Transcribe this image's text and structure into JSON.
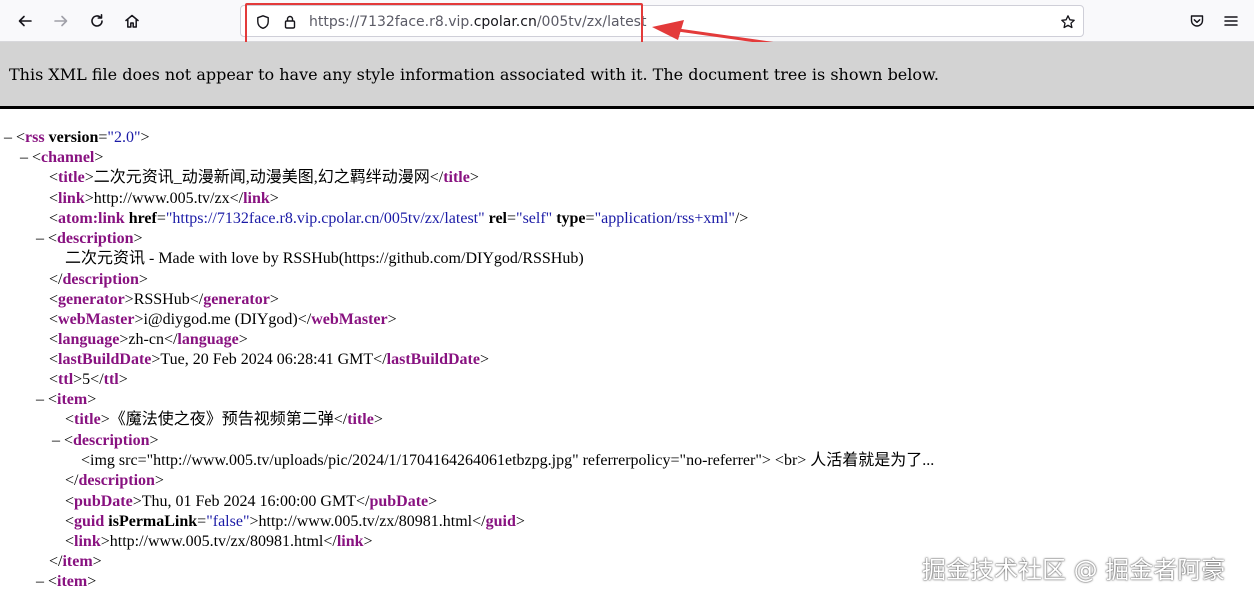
{
  "toolbar": {
    "back_icon": "back-arrow-icon",
    "forward_icon": "forward-arrow-icon",
    "reload_icon": "reload-icon",
    "home_icon": "home-icon",
    "shield_icon": "tracking-protection-shield-icon",
    "lock_icon": "lock-icon",
    "url_prefix": "https://7132face.r8.vip.",
    "url_host": "cpolar.cn",
    "url_path": "/005tv/zx/latest",
    "bookmark_icon": "star-icon",
    "pocket_icon": "pocket-icon",
    "menu_icon": "hamburger-menu-icon",
    "annotation_color": "#e33a3a"
  },
  "banner": {
    "text": "This XML file does not appear to have any style information associated with it. The document tree is shown below."
  },
  "xml": {
    "rss_tag": "rss",
    "rss_attr": "version",
    "rss_val": "\"2.0\"",
    "channel_tag": "channel",
    "title_tag": "title",
    "channel_title": "二次元资讯_动漫新闻,动漫美图,幻之羁绊动漫网",
    "link_tag": "link",
    "channel_link": "http://www.005.tv/zx",
    "atom_tag": "atom:link",
    "atom_href_attr": "href",
    "atom_href_val": "\"https://7132face.r8.vip.cpolar.cn/005tv/zx/latest\"",
    "atom_rel_attr": "rel",
    "atom_rel_val": "\"self\"",
    "atom_type_attr": "type",
    "atom_type_val": "\"application/rss+xml\"",
    "description_tag": "description",
    "channel_description": "二次元资讯 - Made with love by RSSHub(https://github.com/DIYgod/RSSHub)",
    "generator_tag": "generator",
    "generator": "RSSHub",
    "webmaster_tag": "webMaster",
    "webmaster": "i@diygod.me (DIYgod)",
    "language_tag": "language",
    "language": "zh-cn",
    "lastbuild_tag": "lastBuildDate",
    "lastbuild": "Tue, 20 Feb 2024 06:28:41 GMT",
    "ttl_tag": "ttl",
    "ttl": "5",
    "item_tag": "item",
    "item1_title": "《魔法使之夜》预告视频第二弹",
    "item1_description": "<img src=\"http://www.005.tv/uploads/pic/2024/1/1704164264061etbzpg.jpg\" referrerpolicy=\"no-referrer\"> <br> 人活着就是为了...",
    "pubdate_tag": "pubDate",
    "item1_pubdate": "Thu, 01 Feb 2024 16:00:00 GMT",
    "guid_tag": "guid",
    "guid_attr": "isPermaLink",
    "guid_val": "\"false\"",
    "item1_guid": "http://www.005.tv/zx/80981.html",
    "item1_link": "http://www.005.tv/zx/80981.html"
  },
  "watermark": "掘金技术社区 @ 掘金者阿豪"
}
